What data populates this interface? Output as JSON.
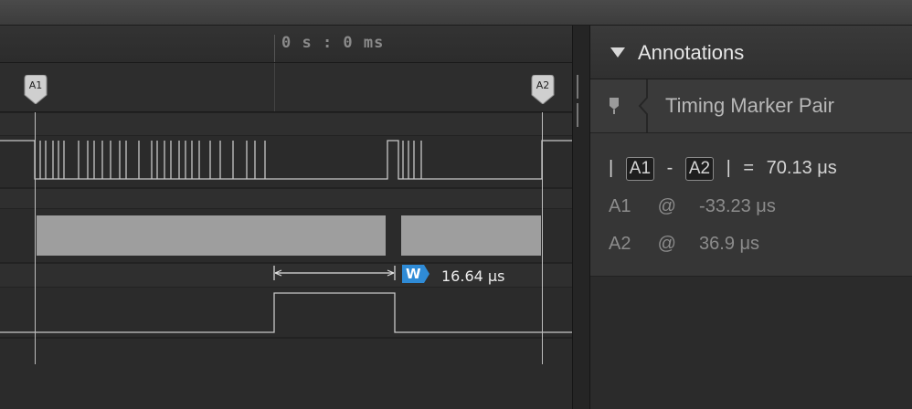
{
  "ruler": {
    "time_label": "0 s : 0 ms"
  },
  "markers": [
    {
      "id": "A1",
      "label": "A1"
    },
    {
      "id": "A2",
      "label": "A2"
    }
  ],
  "measurement": {
    "badge": "W",
    "value": "16.64 μs"
  },
  "annotations": {
    "title": "Annotations",
    "item_label": "Timing Marker Pair",
    "pair": {
      "pipe_left": "|",
      "a1": "A1",
      "dash": "-",
      "a2": "A2",
      "pipe_right": "|",
      "equals": "=",
      "delta": "70.13 μs"
    },
    "a1_row": {
      "name": "A1",
      "at": "@",
      "value": "-33.23 μs"
    },
    "a2_row": {
      "name": "A2",
      "at": "@",
      "value": "36.9 μs"
    }
  },
  "colors": {
    "marker_line": "#bdbdbd",
    "trace": "#c8c8c8",
    "bus_fill": "#9e9e9e",
    "badge_blue": "#2f8bd6"
  }
}
